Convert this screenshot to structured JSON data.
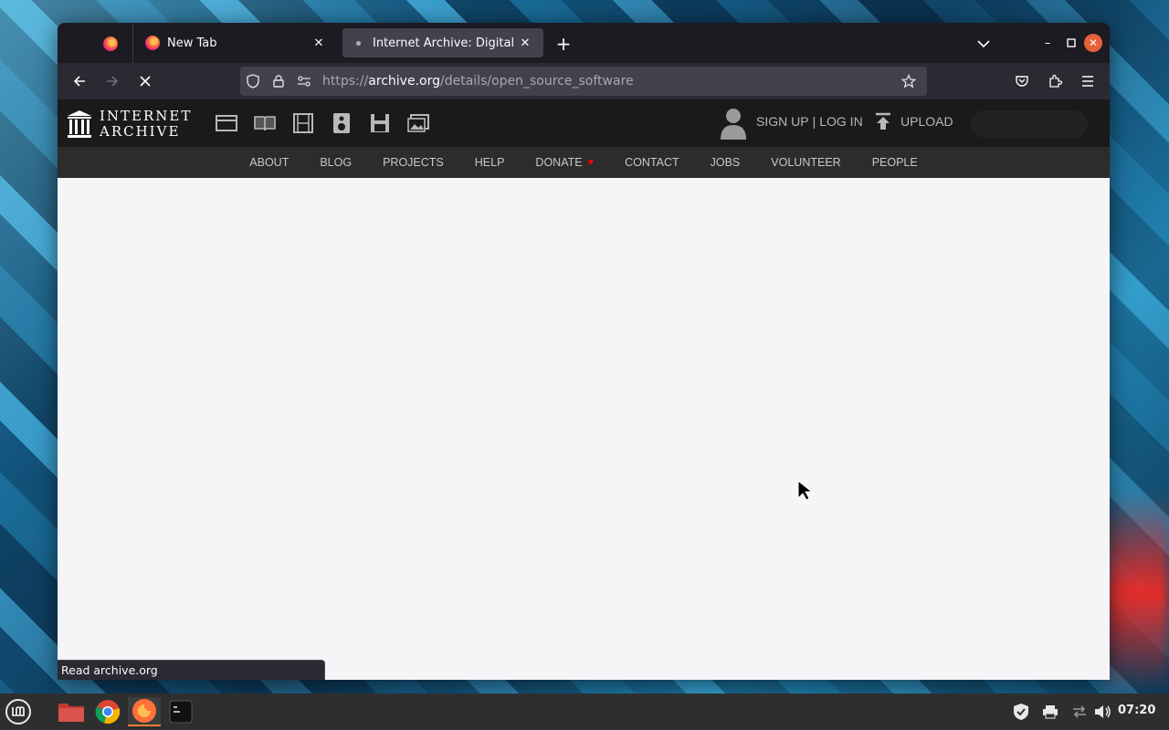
{
  "browser": {
    "tabs": [
      {
        "label": "New Tab"
      },
      {
        "label": "Internet Archive: Digital Lib"
      }
    ],
    "url": {
      "prefix": "https://",
      "host": "archive.org",
      "path": "/details/open_source_software"
    },
    "status_text": "Read archive.org"
  },
  "ia": {
    "logo_line1": "INTERNET",
    "logo_line2": "ARCHIVE",
    "signup": "SIGN UP",
    "auth_sep": "|",
    "login": "LOG IN",
    "upload": "UPLOAD",
    "menu": [
      "ABOUT",
      "BLOG",
      "PROJECTS",
      "HELP",
      "DONATE",
      "CONTACT",
      "JOBS",
      "VOLUNTEER",
      "PEOPLE"
    ],
    "accent": "#ff0100"
  },
  "taskbar": {
    "clock": "07:20"
  }
}
